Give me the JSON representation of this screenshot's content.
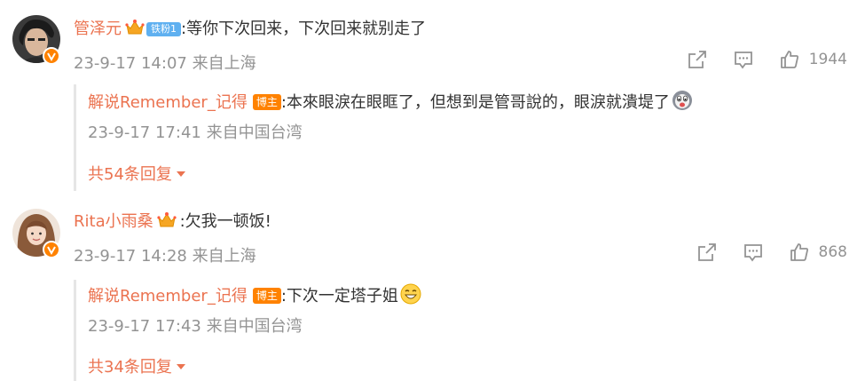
{
  "colors": {
    "username": "#eb7350",
    "meta": "#939393",
    "badge_orange": "#ff8200",
    "fan_badge": "#5fb0f0"
  },
  "comments": [
    {
      "username": "管泽元",
      "fan_badge": "铁粉1",
      "text": ":等你下次回来，下次回来就别走了",
      "time": "23-9-17 14:07",
      "location": "来自上海",
      "likes": "1944",
      "reply": {
        "username": "解说Remember_记得",
        "badge": "博主",
        "text": ":本來眼淚在眼眶了，但想到是管哥說的，眼淚就潰堤了",
        "emoji": "crying-laugh-emoji",
        "time": "23-9-17 17:41",
        "location": "来自中国台湾",
        "more_label": "共54条回复"
      }
    },
    {
      "username": "Rita小雨桑",
      "text": ":欠我一顿饭!",
      "time": "23-9-17 14:28",
      "location": "来自上海",
      "likes": "868",
      "reply": {
        "username": "解说Remember_记得",
        "badge": "博主",
        "text": ":下次一定塔子姐",
        "emoji": "grinning-emoji",
        "time": "23-9-17 17:43",
        "location": "来自中国台湾",
        "more_label": "共34条回复"
      }
    }
  ]
}
